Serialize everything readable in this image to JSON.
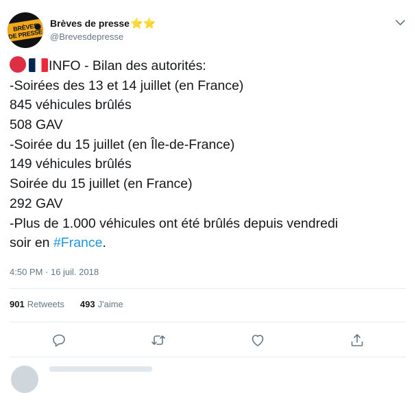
{
  "tweet": {
    "author": {
      "display_name": "Brèves de presse",
      "name_emoji": "⭐⭐",
      "handle": "@Brevesdepresse",
      "avatar_text": [
        "BRÈVES",
        "DE PRESSE"
      ]
    },
    "body": {
      "first_line": "INFO - Bilan des autorités:",
      "lines": [
        "-Soirées des 13 et 14 juillet (en France)",
        "845 véhicules brûlés",
        "508 GAV",
        "-Soirée du 15 juillet (en Île-de-France)",
        "149 véhicules brûlés",
        "Soirée du 15 juillet (en France)",
        "292 GAV",
        "-Plus de 1.000 véhicules ont été brûlés depuis vendredi"
      ],
      "last_line_prefix": "soir en ",
      "hashtag": "#France",
      "last_line_suffix": "."
    },
    "timestamp": "4:50 PM · 16 juil. 2018",
    "stats": {
      "retweets_count": "901",
      "retweets_label": "Retweets",
      "likes_count": "493",
      "likes_label": "J'aime"
    },
    "icons": {
      "menu": "chevron-down-icon",
      "reply": "reply-icon",
      "retweet": "retweet-icon",
      "like": "heart-icon",
      "share": "share-icon",
      "flags": [
        "red-circle-icon",
        "france-flag-icon"
      ]
    },
    "colors": {
      "text": "#14171a",
      "secondary": "#657786",
      "link": "#1b95e0",
      "divider": "#e6ecf0",
      "star": "#f5b400"
    }
  }
}
